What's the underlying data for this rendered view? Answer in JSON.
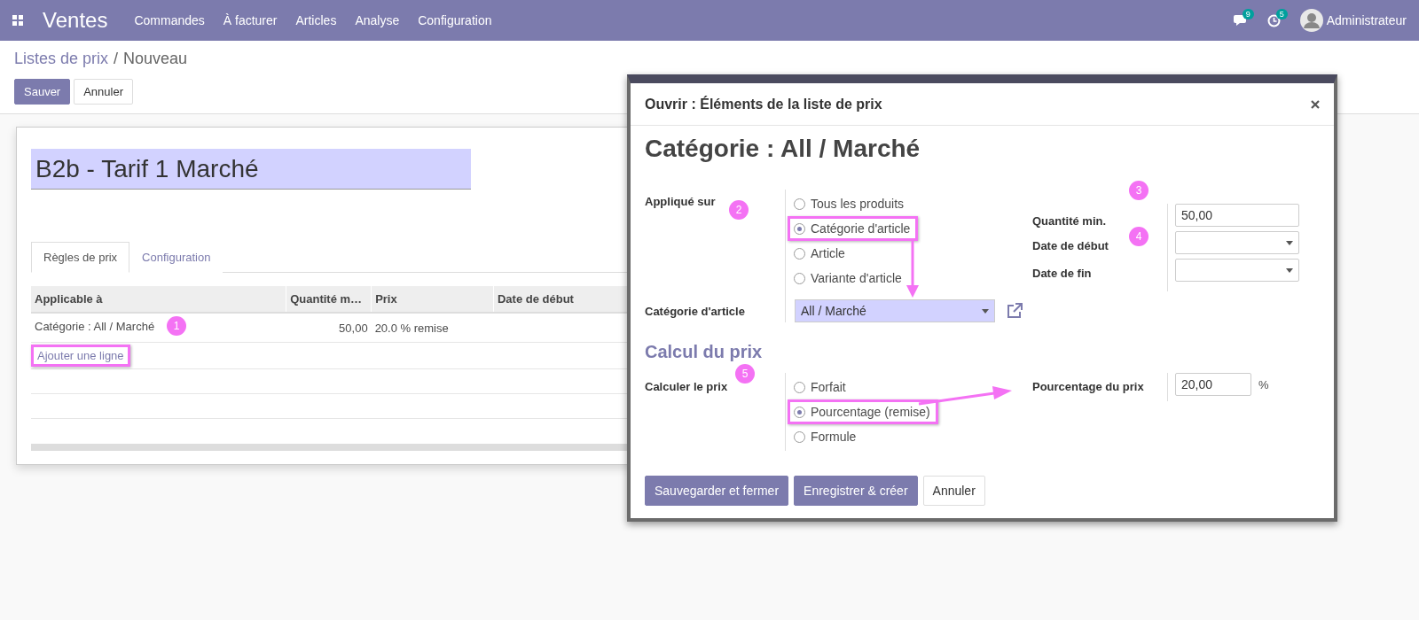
{
  "navbar": {
    "app_title": "Ventes",
    "menu": [
      "Commandes",
      "À facturer",
      "Articles",
      "Analyse",
      "Configuration"
    ],
    "messages_badge": "9",
    "activities_badge": "5",
    "user": "Administrateur"
  },
  "breadcrumb": {
    "parent": "Listes de prix",
    "separator": "/",
    "current": "Nouveau"
  },
  "actions": [
    {
      "label": "Sauver",
      "kind": "primary"
    },
    {
      "label": "Annuler",
      "kind": "secondary"
    }
  ],
  "record": {
    "name": "B2b - Tarif 1 Marché",
    "tabs": [
      {
        "label": "Règles de prix",
        "selected": true
      },
      {
        "label": "Configuration",
        "selected": false
      }
    ],
    "table": {
      "columns": [
        "Applicable à",
        "Quantité m…",
        "Prix",
        "Date de début"
      ],
      "rows": [
        {
          "applicable": "Catégorie : All / Marché",
          "quantity": "50,00",
          "price": "20.0 % remise",
          "marker": "1"
        }
      ]
    },
    "add_line": {
      "label": "Ajouter une ligne",
      "highlighted": true
    }
  },
  "dialog": {
    "title": "Ouvrir : Éléments de la liste de prix",
    "heading": "Catégorie : All / Marché",
    "applied_on": {
      "label": "Appliqué sur",
      "marker": "2",
      "options": [
        {
          "label": "Tous les produits",
          "selected": false,
          "highlighted": false
        },
        {
          "label": "Catégorie d'article",
          "selected": true,
          "highlighted": true
        },
        {
          "label": "Article",
          "selected": false,
          "highlighted": false
        },
        {
          "label": "Variante d'article",
          "selected": false,
          "highlighted": false
        }
      ]
    },
    "category": {
      "label": "Catégorie d'article",
      "value": "All / Marché"
    },
    "min_quantity": {
      "label": "Quantité min.",
      "value": "50,00",
      "marker": "3"
    },
    "date_start": {
      "label": "Date de début",
      "marker": "4"
    },
    "date_end": {
      "label": "Date de fin"
    },
    "section": "Calcul du prix",
    "compute": {
      "label": "Calculer le prix",
      "marker": "5",
      "options": [
        {
          "label": "Forfait",
          "selected": false,
          "highlighted": false
        },
        {
          "label": "Pourcentage (remise)",
          "selected": true,
          "highlighted": true
        },
        {
          "label": "Formule",
          "selected": false,
          "highlighted": false
        }
      ]
    },
    "percentage": {
      "label": "Pourcentage du prix",
      "value": "20,00",
      "unit": "%"
    },
    "buttons": [
      {
        "label": "Sauvegarder et fermer",
        "kind": "primary"
      },
      {
        "label": "Enregistrer & créer",
        "kind": "primary"
      },
      {
        "label": "Annuler",
        "kind": "secondary"
      }
    ]
  }
}
